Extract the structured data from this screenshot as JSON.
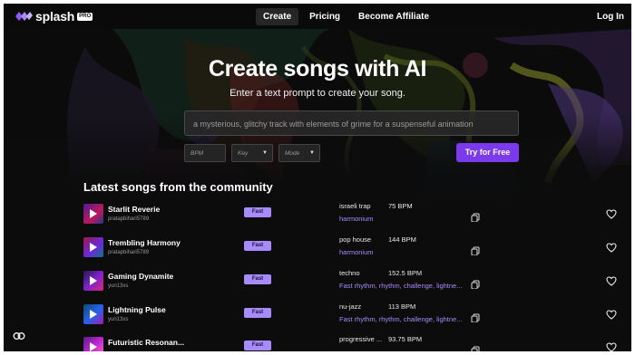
{
  "brand": {
    "name": "splash",
    "badge": "PRO"
  },
  "nav": {
    "items": [
      {
        "label": "Create",
        "active": true
      },
      {
        "label": "Pricing",
        "active": false
      },
      {
        "label": "Become Affiliate",
        "active": false
      }
    ],
    "login": "Log In"
  },
  "hero": {
    "title": "Create songs with AI",
    "subtitle": "Enter a text prompt to create your song.",
    "prompt_placeholder": "a mysterious, glitchy track with elements of grime for a suspenseful animation",
    "bpm_placeholder": "BPM",
    "key_placeholder": "Key",
    "mode_placeholder": "Mode",
    "cta": "Try for Free"
  },
  "community": {
    "title": "Latest songs from the community",
    "songs": [
      {
        "name": "Starlit Reverie",
        "user": "pratapbihari5789",
        "badge": "Fast",
        "genre": "israeli trap",
        "bpm": "75 BPM",
        "tags": "harmonium"
      },
      {
        "name": "Trembling Harmony",
        "user": "pratapbihari5789",
        "badge": "Fast",
        "genre": "pop house",
        "bpm": "144 BPM",
        "tags": "harmonium"
      },
      {
        "name": "Gaming Dynamite",
        "user": "yun13xs",
        "badge": "Fast",
        "genre": "techno",
        "bpm": "152.5 BPM",
        "tags": "Fast rhythm, rhythm, challenge, lightne..."
      },
      {
        "name": "Lightning Pulse",
        "user": "yun13xs",
        "badge": "Fast",
        "genre": "nu-jazz",
        "bpm": "113 BPM",
        "tags": "Fast rhythm, rhythm, challenge, lightne..."
      },
      {
        "name": "Futuristic Resonan...",
        "user": "",
        "badge": "Fast",
        "genre": "progressive ...",
        "bpm": "93.75 BPM",
        "tags": ""
      }
    ]
  },
  "colors": {
    "accent": "#7c3aed",
    "badge": "#a78bfa",
    "background": "#0c0c0c"
  },
  "icons": [
    "splash-logo-icon",
    "play-icon",
    "copy-icon",
    "heart-icon",
    "cookie-settings-icon"
  ]
}
